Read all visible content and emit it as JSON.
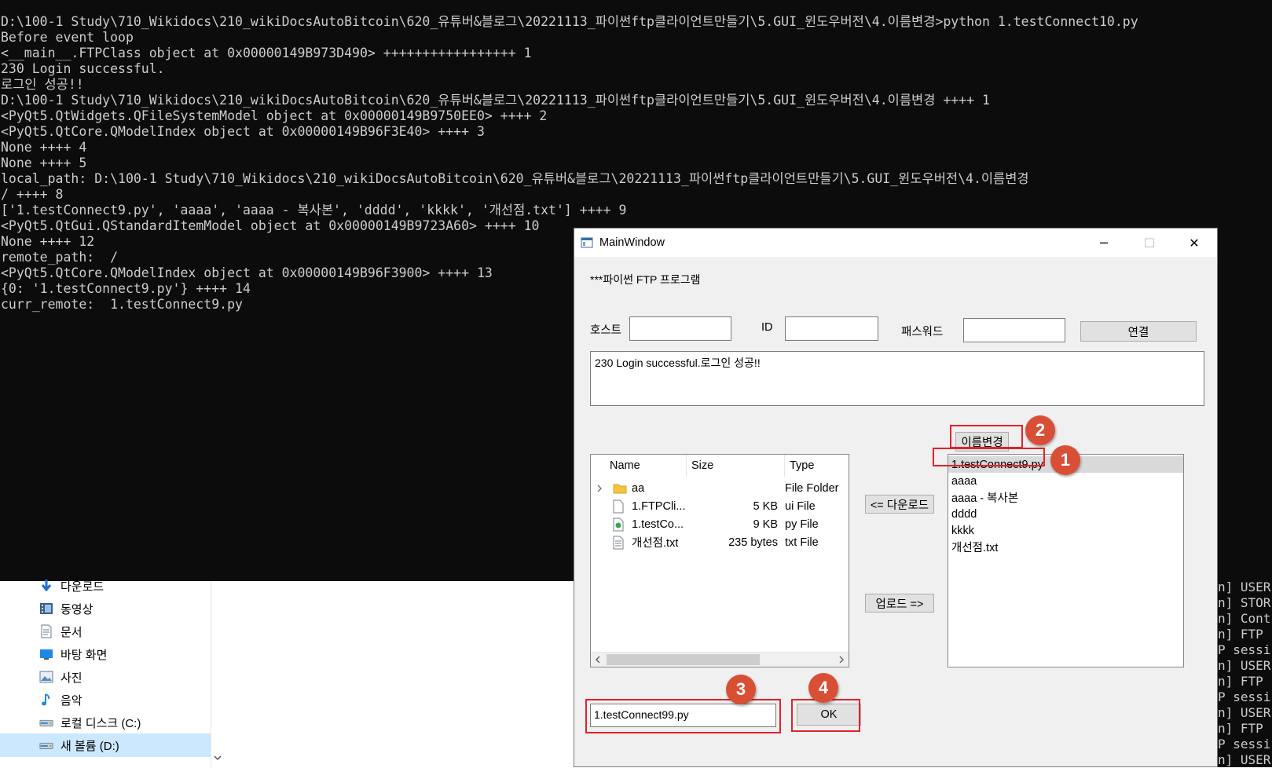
{
  "console": {
    "lines": [
      "D:\\100-1 Study\\710_Wikidocs\\210_wikiDocsAutoBitcoin\\620_유튜버&블로그\\20221113_파이썬ftp클라이언트만들기\\5.GUI_윈도우버전\\4.이름변경>python 1.testConnect10.py",
      "Before event loop",
      "<__main__.FTPClass object at 0x00000149B973D490> +++++++++++++++++ 1",
      "230 Login successful.",
      "로그인 성공!!",
      "D:\\100-1 Study\\710_Wikidocs\\210_wikiDocsAutoBitcoin\\620_유튜버&블로그\\20221113_파이썬ftp클라이언트만들기\\5.GUI_윈도우버전\\4.이름변경 ++++ 1",
      "<PyQt5.QtWidgets.QFileSystemModel object at 0x00000149B9750EE0> ++++ 2",
      "<PyQt5.QtCore.QModelIndex object at 0x00000149B96F3E40> ++++ 3",
      "None ++++ 4",
      "None ++++ 5",
      "local_path: D:\\100-1 Study\\710_Wikidocs\\210_wikiDocsAutoBitcoin\\620_유튜버&블로그\\20221113_파이썬ftp클라이언트만들기\\5.GUI_윈도우버전\\4.이름변경",
      "/ ++++ 8",
      "['1.testConnect9.py', 'aaaa', 'aaaa - 복사본', 'dddd', 'kkkk', '개선점.txt'] ++++ 9",
      "<PyQt5.QtGui.QStandardItemModel object at 0x00000149B9723A60> ++++ 10",
      "None ++++ 12",
      "remote_path:  /",
      "<PyQt5.QtCore.QModelIndex object at 0x00000149B96F3900> ++++ 13",
      "{0: '1.testConnect9.py'} ++++ 14",
      "curr_remote:  1.testConnect9.py"
    ],
    "strip": [
      "n] USER",
      "n] STOR",
      "n] Cont",
      "n] FTP s",
      "P sessi",
      "n] USER",
      "n] FTP s",
      "P sessi",
      "n] USER",
      "n] FTP s",
      "P sessi",
      "n] USER"
    ]
  },
  "explorer": {
    "items": [
      {
        "label": "다운로드",
        "icon": "download-arrow-icon"
      },
      {
        "label": "동영상",
        "icon": "video-icon"
      },
      {
        "label": "문서",
        "icon": "document-icon"
      },
      {
        "label": "바탕 화면",
        "icon": "desktop-icon"
      },
      {
        "label": "사진",
        "icon": "picture-icon"
      },
      {
        "label": "음악",
        "icon": "music-note-icon"
      },
      {
        "label": "로컬 디스크 (C:)",
        "icon": "drive-icon"
      },
      {
        "label": "새 볼륨 (D:)",
        "icon": "drive-icon"
      }
    ]
  },
  "window": {
    "title": "MainWindow",
    "minimize": "─",
    "maximize": "☐",
    "close": "✕",
    "heading": "***파이썬 FTP 프로그램",
    "host_label": "호스트",
    "host_value": "",
    "id_label": "ID",
    "id_value": "",
    "password_label": "패스워드",
    "password_value": "",
    "connect_button": "연결",
    "log_text": "230 Login successful.로그인 성공!!",
    "rename_button": "이름변경",
    "download_button": "<= 다운로드",
    "upload_button": "업로드 =>",
    "rename_input_value": "1.testConnect99.py",
    "ok_button": "OK",
    "local_tree": {
      "columns": [
        "Name",
        "Size",
        "Type"
      ],
      "rows": [
        {
          "name": "aa",
          "size": "",
          "type": "File Folder",
          "icon": "folder-icon",
          "expandable": true
        },
        {
          "name": "1.FTPCli...",
          "size": "5 KB",
          "type": "ui File",
          "icon": "file-icon",
          "expandable": false
        },
        {
          "name": "1.testCo...",
          "size": "9 KB",
          "type": "py File",
          "icon": "python-file-icon",
          "expandable": false
        },
        {
          "name": "개선점.txt",
          "size": "235 bytes",
          "type": "txt File",
          "icon": "text-file-icon",
          "expandable": false
        }
      ]
    },
    "remote_list": {
      "items": [
        "1.testConnect9.py",
        "aaaa",
        "aaaa - 복사본",
        "dddd",
        "kkkk",
        "개선점.txt"
      ],
      "selected_index": 0
    },
    "badges": [
      "1",
      "2",
      "3",
      "4"
    ]
  },
  "colors": {
    "console_bg": "#0c0c0c",
    "console_fg": "#cccccc",
    "annotation_red": "#e2222a",
    "badge_fill": "#d94f36",
    "window_bg": "#f0f0f0"
  }
}
